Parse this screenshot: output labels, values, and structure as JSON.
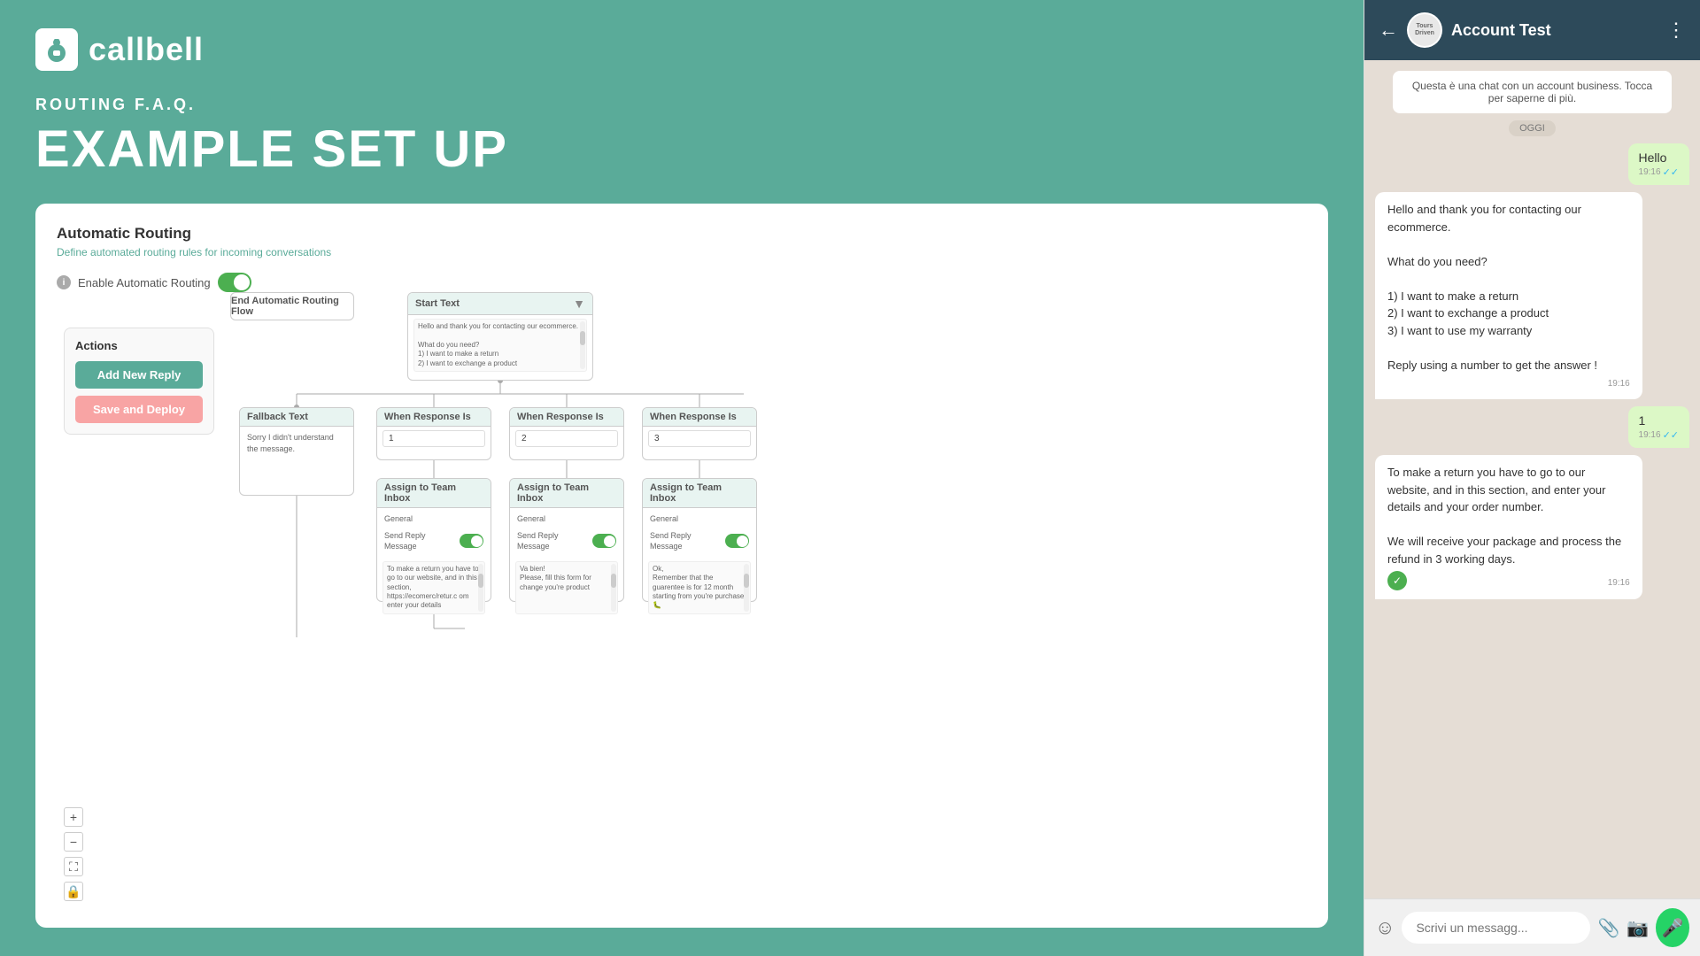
{
  "logo": {
    "text": "callbell"
  },
  "header": {
    "routing_label": "ROUTING F.A.Q.",
    "example_title": "EXAMPLE SET UP"
  },
  "card": {
    "title": "Automatic Routing",
    "subtitle": "Define automated routing rules for incoming conversations",
    "enable_label": "Enable Automatic Routing",
    "actions_title": "Actions",
    "btn_add_reply": "Add New Reply",
    "btn_save_deploy": "Save and Deploy"
  },
  "flow": {
    "start_node_title": "Start Text",
    "start_node_content": "Hello and thank you for contacting our ecommerce.\n\nWhat do you need?\n1) I want to make a return\n2) I want to exchange a product",
    "fallback_title": "Fallback Text",
    "fallback_content": "Sorry I didn't understand the message.",
    "when_response_title": "When Response Is",
    "when_response_1_value": "1",
    "when_response_2_value": "2",
    "when_response_3_value": "3",
    "assign_title": "Assign to Team Inbox",
    "assign_team_label": "General",
    "send_reply_label": "Send Reply Message",
    "assign_1_content": "To make a return you have to go to our website, and in this section, https://ecomerc/retur.c om enter your details",
    "assign_2_content": "Va bien!\nPlease, fill this form for change you're product",
    "assign_3_content": "Ok,\nRemember that the guarentee is for 12 month starting from you're purchase 🐛",
    "end_label": "End Automatic Routing Flow"
  },
  "zoom": {
    "plus": "+",
    "minus": "−",
    "fullscreen": "⛶",
    "lock": "🔒"
  },
  "chat": {
    "back_icon": "←",
    "menu_icon": "⋮",
    "title": "Account Test",
    "avatar_text": "ToursDriven",
    "info_banner": "Questa è una chat con un account business. Tocca per saperne di più.",
    "date_label": "OGGI",
    "msg_hello": "Hello",
    "msg_hello_time": "19:16",
    "msg_bot_text": "Hello and thank you for contacting our ecommerce.\n\nWhat do you need?\n\n1) I want to make a return\n2) I want to exchange a product\n3) I want to use my warranty\n\nReply using a number to get the answer !",
    "msg_bot_time": "19:16",
    "msg_1": "1",
    "msg_1_time": "19:16",
    "msg_return": "To make a return you have to go to our website, and in this section, and enter your details and your order number.\n\nWe will receive your package and process the refund in 3 working days.",
    "msg_return_time": "19:16",
    "input_placeholder": "Scrivi un messagg..."
  }
}
